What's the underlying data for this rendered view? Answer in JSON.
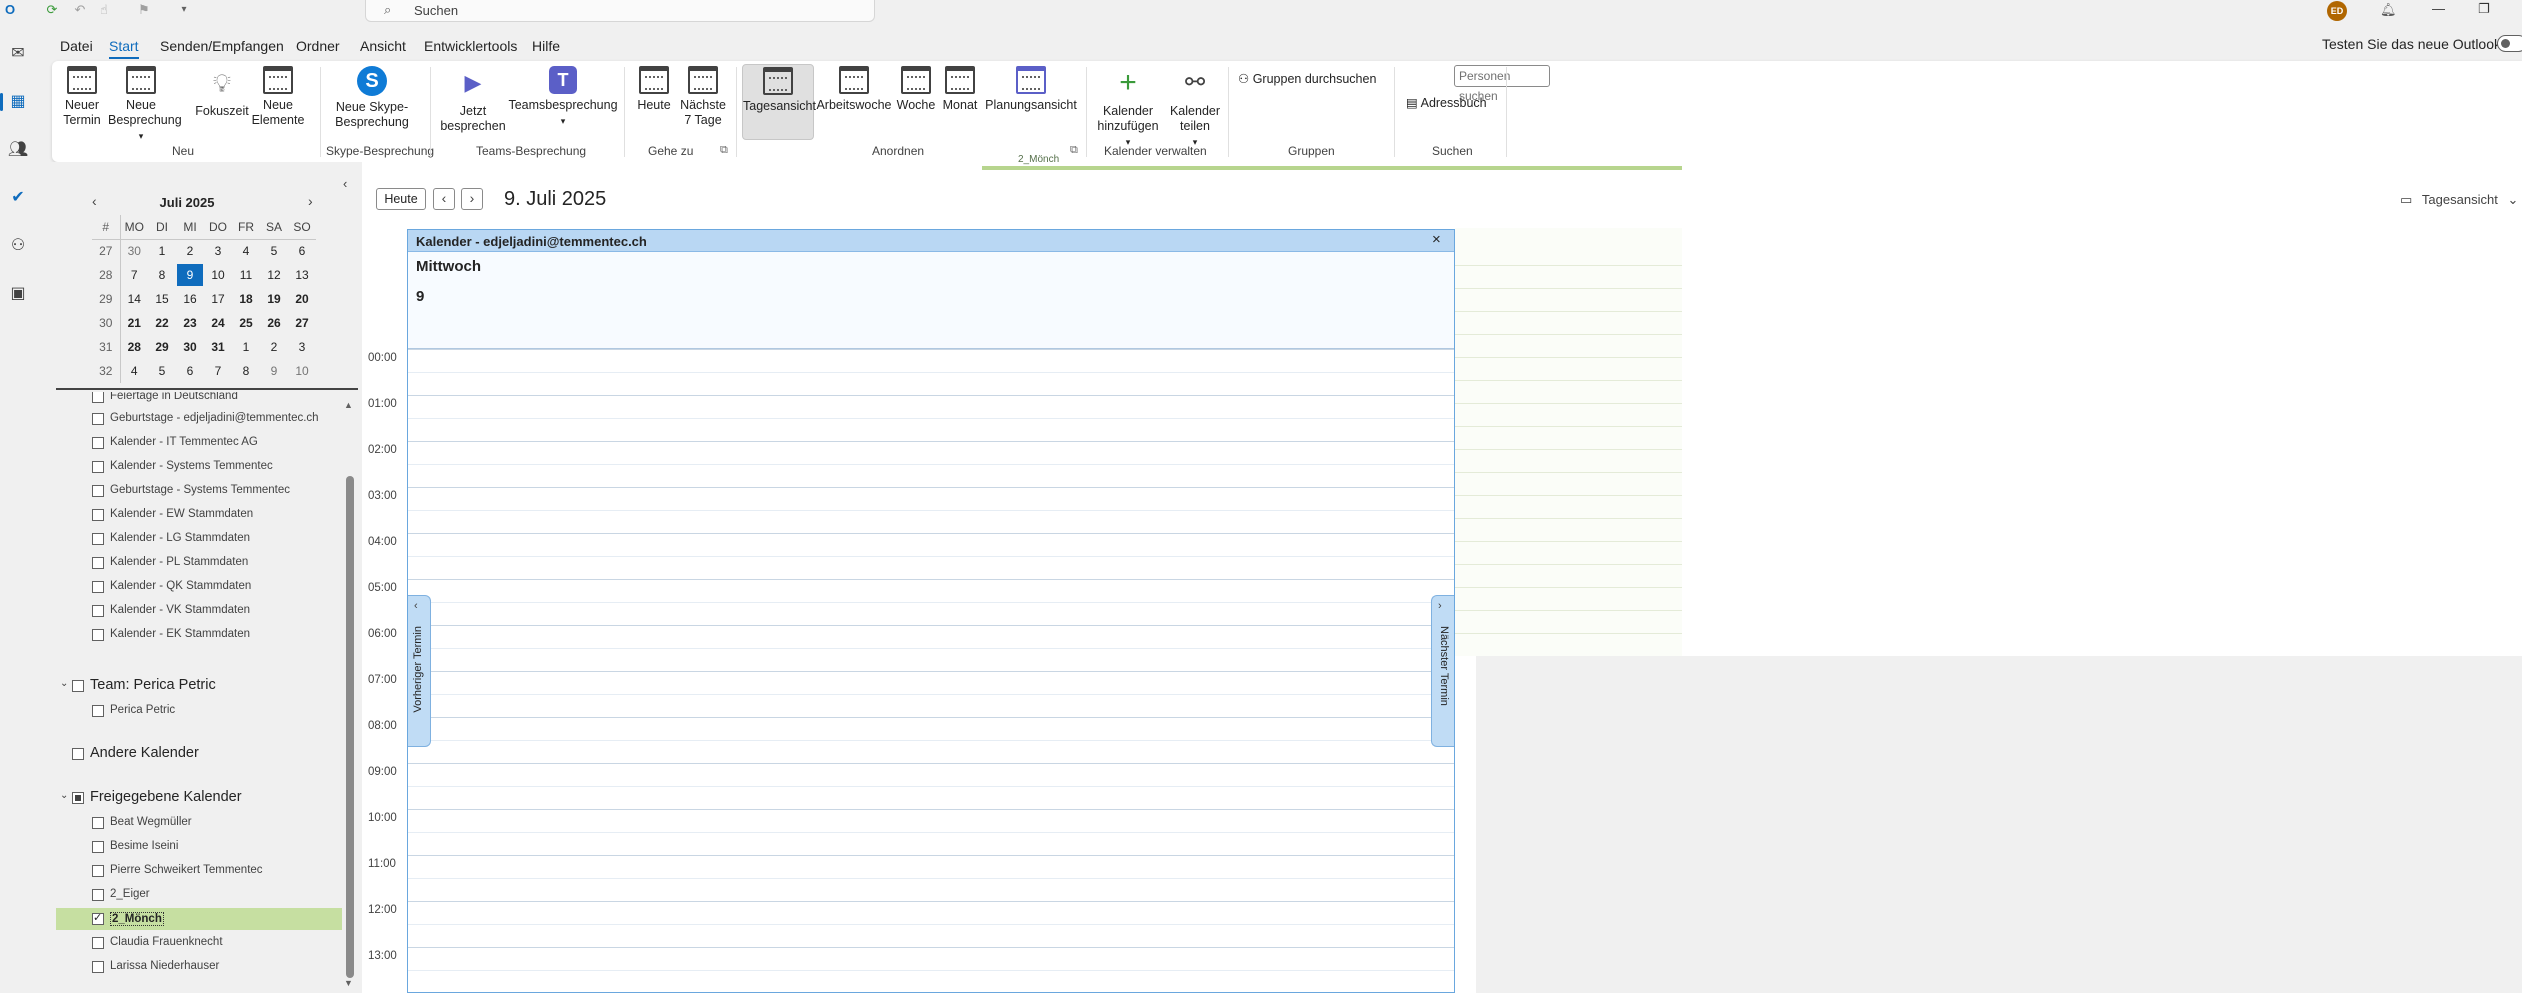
{
  "titlebar": {
    "search_placeholder": "Suchen",
    "avatar_initials": "ED"
  },
  "menu": {
    "tabs": [
      "Datei",
      "Start",
      "Senden/Empfangen",
      "Ordner",
      "Ansicht",
      "Entwicklertools",
      "Hilfe"
    ],
    "active_tab": "Start",
    "try_new_outlook": "Testen Sie das neue Outlook"
  },
  "ribbon": {
    "neu": {
      "group": "Neu",
      "new_appointment": "Neuer Termin",
      "new_meeting": "Neue Besprechung",
      "focus_time": "Fokuszeit",
      "new_items": "Neue Elemente"
    },
    "skype": {
      "group": "Skype-Besprechung",
      "new_skype": "Neue Skype-Besprechung"
    },
    "teams": {
      "group": "Teams-Besprechung",
      "meet_now": "Jetzt besprechen",
      "teams_meeting": "Teamsbesprechung"
    },
    "goto": {
      "group": "Gehe zu",
      "today": "Heute",
      "next7": "Nächste 7 Tage"
    },
    "arrange": {
      "group": "Anordnen",
      "day": "Tagesansicht",
      "workweek": "Arbeitswoche",
      "week": "Woche",
      "month": "Monat",
      "schedule": "Planungsansicht"
    },
    "manage": {
      "group": "Kalender verwalten",
      "add": "Kalender hinzufügen",
      "share": "Kalender teilen"
    },
    "groups": {
      "group": "Gruppen",
      "browse": "Gruppen durchsuchen"
    },
    "search": {
      "group": "Suchen",
      "people_placeholder": "Personen suchen",
      "address_book": "Adressbuch"
    }
  },
  "minical": {
    "title": "Juli 2025",
    "headers": [
      "#",
      "MO",
      "DI",
      "MI",
      "DO",
      "FR",
      "SA",
      "SO"
    ],
    "weeks": [
      [
        "27",
        "30",
        "1",
        "2",
        "3",
        "4",
        "5",
        "6"
      ],
      [
        "28",
        "7",
        "8",
        "9",
        "10",
        "11",
        "12",
        "13"
      ],
      [
        "29",
        "14",
        "15",
        "16",
        "17",
        "18",
        "19",
        "20"
      ],
      [
        "30",
        "21",
        "22",
        "23",
        "24",
        "25",
        "26",
        "27"
      ],
      [
        "31",
        "28",
        "29",
        "30",
        "31",
        "1",
        "2",
        "3"
      ],
      [
        "32",
        "4",
        "5",
        "6",
        "7",
        "8",
        "9",
        "10"
      ]
    ]
  },
  "folders": {
    "my_calendars": [
      "Feiertage in Deutschland",
      "Geburtstage - edjeljadini@temmentec.ch",
      "Kalender - IT Temmentec AG",
      "Kalender - Systems Temmentec",
      "Geburtstage - Systems Temmentec",
      "Kalender - EW Stammdaten",
      "Kalender - LG Stammdaten",
      "Kalender - PL Stammdaten",
      "Kalender - QK Stammdaten",
      "Kalender - VK Stammdaten",
      "Kalender - EK Stammdaten"
    ],
    "team_group": "Team: Perica Petric",
    "team_members": [
      "Perica Petric"
    ],
    "other_group": "Andere Kalender",
    "shared_group": "Freigegebene Kalender",
    "shared": [
      "Beat Wegmüller",
      "Besime Iseini",
      "Pierre Schweikert Temmentec",
      "2_Eiger",
      "2_Mönch",
      "Claudia Frauenknecht",
      "Larissa Niederhauser"
    ],
    "selected": "2_Mönch"
  },
  "main": {
    "today_btn": "Heute",
    "date_title": "9. Juli 2025",
    "view_switch": "Tagesansicht",
    "background_strip_label": "2_Mönch"
  },
  "popup": {
    "title": "Kalender - edjeljadini@temmentec.ch",
    "day_name": "Mittwoch",
    "day_number": "9",
    "prev": "Vorheriger Termin",
    "next": "Nächster Termin",
    "times": [
      "00:00",
      "01:00",
      "02:00",
      "03:00",
      "04:00",
      "05:00",
      "06:00",
      "07:00",
      "08:00",
      "09:00",
      "10:00",
      "11:00",
      "12:00",
      "13:00"
    ]
  },
  "colors": {
    "accent": "#0f6cbd",
    "selected_row": "#c6dfa1",
    "popup_header": "#b9d7f3"
  }
}
